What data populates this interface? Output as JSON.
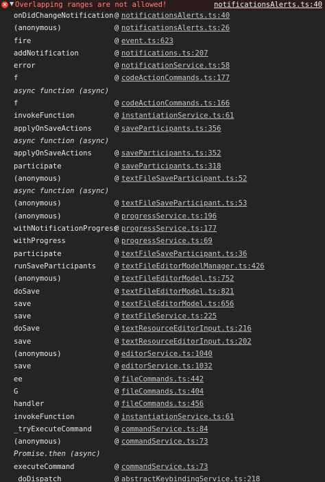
{
  "header": {
    "error_icon": "x-circle-icon",
    "toggle_glyph": "▼",
    "message": "Overlapping ranges are not allowed!",
    "source": "notificationsAlerts.ts:40",
    "colors": {
      "error_text": "#ff8080",
      "error_bg": "#2b1b1b",
      "error_icon": "#e0443e"
    }
  },
  "at_symbol": "@",
  "frames": [
    {
      "fn": "onDidChangeNotification",
      "src": "notificationsAlerts.ts:40"
    },
    {
      "fn": "(anonymous)",
      "src": "notificationsAlerts.ts:26"
    },
    {
      "fn": "fire",
      "src": "event.ts:623"
    },
    {
      "fn": "addNotification",
      "src": "notifications.ts:207"
    },
    {
      "fn": "error",
      "src": "notificationService.ts:58"
    },
    {
      "fn": "f",
      "src": "codeActionCommands.ts:177"
    },
    {
      "async": "async function (async)"
    },
    {
      "fn": "f",
      "src": "codeActionCommands.ts:166"
    },
    {
      "fn": "invokeFunction",
      "src": "instantiationService.ts:61"
    },
    {
      "fn": "applyOnSaveActions",
      "src": "saveParticipants.ts:356"
    },
    {
      "async": "async function (async)"
    },
    {
      "fn": "applyOnSaveActions",
      "src": "saveParticipants.ts:352"
    },
    {
      "fn": "participate",
      "src": "saveParticipants.ts:318"
    },
    {
      "fn": "(anonymous)",
      "src": "textFileSaveParticipant.ts:52"
    },
    {
      "async": "async function (async)"
    },
    {
      "fn": "(anonymous)",
      "src": "textFileSaveParticipant.ts:53"
    },
    {
      "fn": "(anonymous)",
      "src": "progressService.ts:196"
    },
    {
      "fn": "withNotificationProgress",
      "src": "progressService.ts:177"
    },
    {
      "fn": "withProgress",
      "src": "progressService.ts:69"
    },
    {
      "fn": "participate",
      "src": "textFileSaveParticipant.ts:36"
    },
    {
      "fn": "runSaveParticipants",
      "src": "textFileEditorModelManager.ts:426"
    },
    {
      "fn": "(anonymous)",
      "src": "textFileEditorModel.ts:752"
    },
    {
      "fn": "doSave",
      "src": "textFileEditorModel.ts:821"
    },
    {
      "fn": "save",
      "src": "textFileEditorModel.ts:656"
    },
    {
      "fn": "save",
      "src": "textFileService.ts:225"
    },
    {
      "fn": "doSave",
      "src": "textResourceEditorInput.ts:216"
    },
    {
      "fn": "save",
      "src": "textResourceEditorInput.ts:202"
    },
    {
      "fn": "(anonymous)",
      "src": "editorService.ts:1040"
    },
    {
      "fn": "save",
      "src": "editorService.ts:1032"
    },
    {
      "fn": "ee",
      "src": "fileCommands.ts:442"
    },
    {
      "fn": "G",
      "src": "fileCommands.ts:404"
    },
    {
      "fn": "handler",
      "src": "fileCommands.ts:456"
    },
    {
      "fn": "invokeFunction",
      "src": "instantiationService.ts:61"
    },
    {
      "fn": "_tryExecuteCommand",
      "src": "commandService.ts:84"
    },
    {
      "fn": "(anonymous)",
      "src": "commandService.ts:73"
    },
    {
      "async": "Promise.then (async)"
    },
    {
      "fn": "executeCommand",
      "src": "commandService.ts:73"
    },
    {
      "fn": "_doDispatch",
      "src": "abstractKeybindingService.ts:218"
    }
  ]
}
